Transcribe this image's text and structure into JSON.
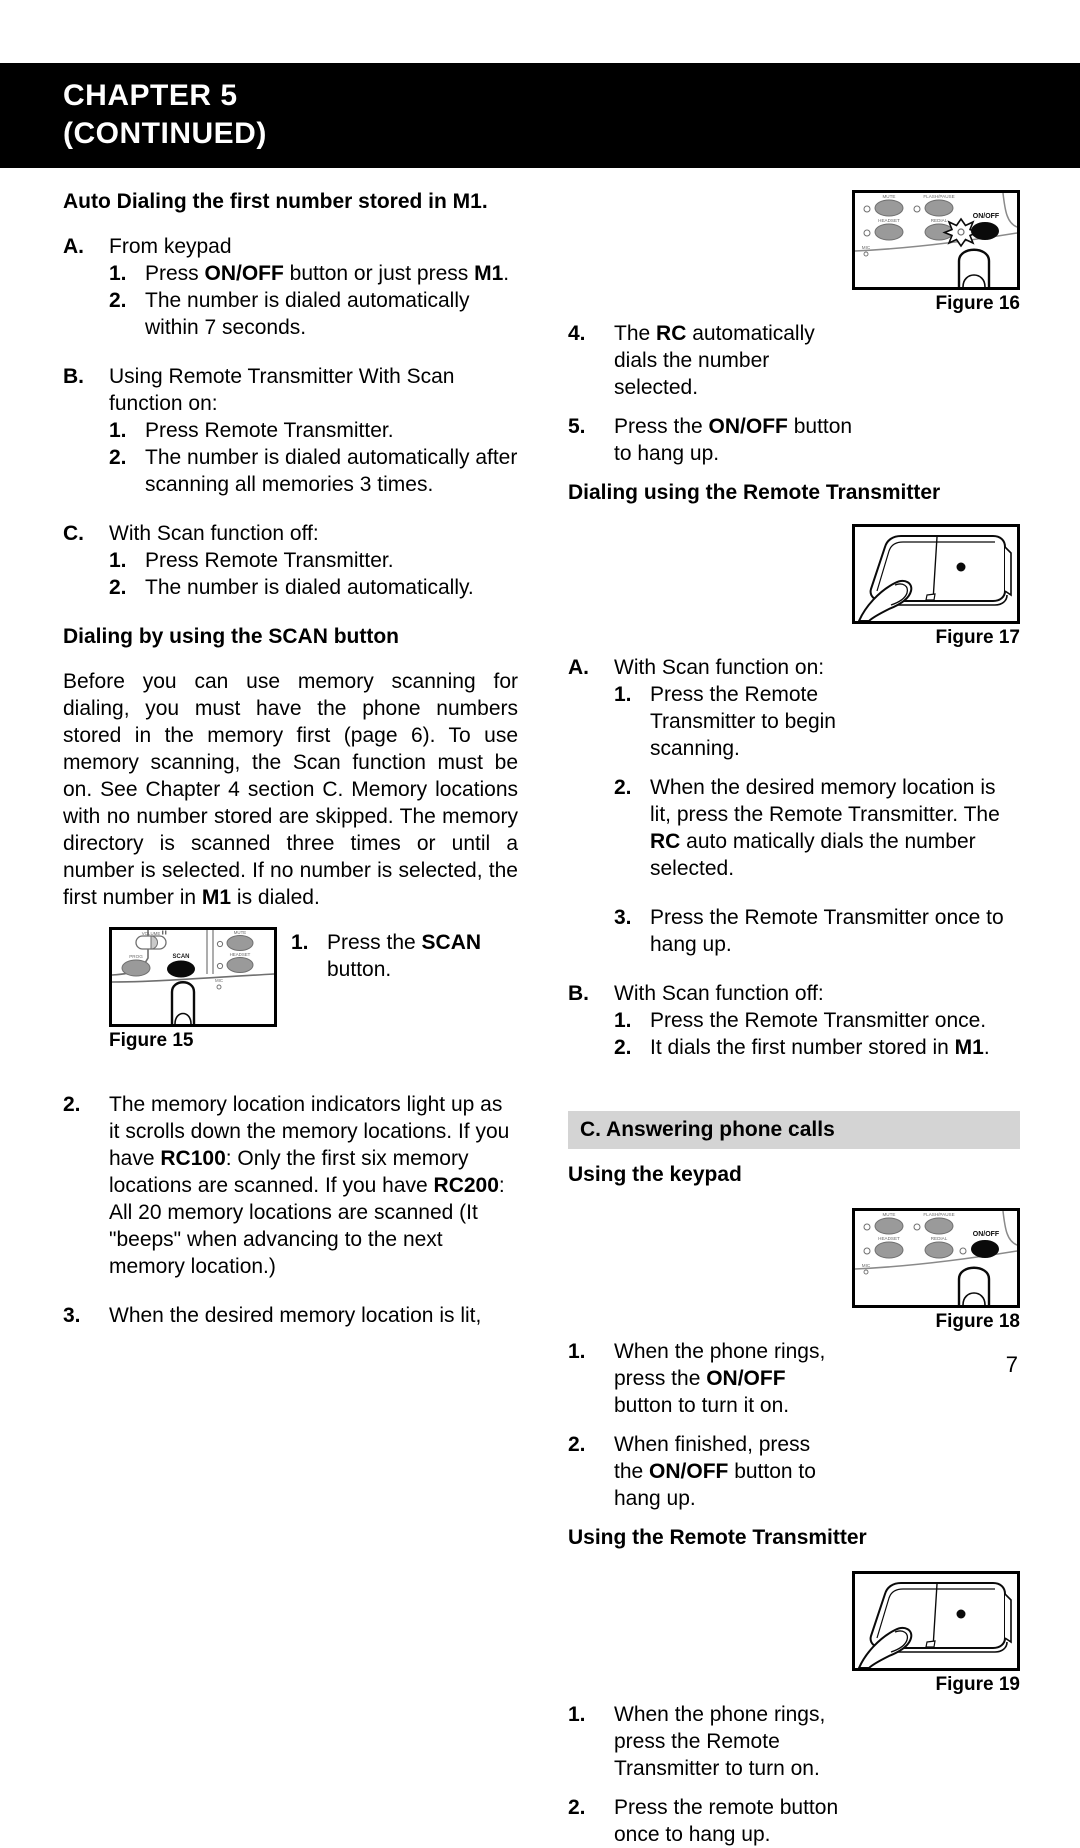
{
  "header": {
    "line1": "CHAPTER 5",
    "line2": "(CONTINUED)"
  },
  "page_number": "7",
  "colors": {
    "header_band": "#000000",
    "section_band": "#d4d4d4",
    "button_grey": "#9a9a9a",
    "text": "#000000"
  },
  "left_column": {
    "heading_auto_dial": "Auto Dialing the first number stored in M1.",
    "item_a": {
      "marker": "A.",
      "text": "From keypad"
    },
    "item_a1": {
      "marker": "1.",
      "pre": "Press ",
      "bold": "ON/OFF",
      "post": " button or just press ",
      "bold2": "M1",
      "tail": "."
    },
    "item_a2": {
      "marker": "2.",
      "text": "The number is dialed automatically within 7 seconds."
    },
    "item_b": {
      "marker": "B.",
      "text": "Using Remote Transmitter With Scan function on:"
    },
    "item_b1": {
      "marker": "1.",
      "text": "Press Remote Transmitter."
    },
    "item_b2": {
      "marker": "2.",
      "text": "The number is dialed automatically after scanning all memories 3 times."
    },
    "item_c": {
      "marker": "C.",
      "text": "With Scan function off:"
    },
    "item_c1": {
      "marker": "1.",
      "text": "Press Remote Transmitter."
    },
    "item_c2": {
      "marker": "2.",
      "text": "The number is dialed automatically."
    },
    "heading_scan": {
      "pre": "Dialing by using the ",
      "bold": "SCAN",
      "post": " button"
    },
    "paragraph_scan": "Before you can use memory scanning for dialing, you must have the phone numbers stored in the memory first (page 6). To use memory scanning, the Scan function must be on. See Chapter 4 section C.  Memory locations with no number stored are skipped. The memory directory is scanned three times or until a number is selected. If no number is selected, the first number in ",
    "paragraph_scan_bold": "M1",
    "paragraph_scan_tail": " is dialed.",
    "step_1": {
      "marker": "1.",
      "pre": "Press the ",
      "bold": "SCAN",
      "post": " button."
    },
    "step_2": {
      "marker": "2.",
      "text_a": "The memory location indicators light up as it scrolls down the memory locations. If you have ",
      "bold_a": "RC100",
      "text_b": ": Only the first six memory locations are scanned. If you have ",
      "bold_b": "RC200",
      "text_c": ": All 20 memory locations are scanned (It \"beeps\" when advancing to the next memory location.)"
    },
    "step_3": {
      "marker": "3.",
      "text": "When the desired memory location is lit,"
    }
  },
  "right_column": {
    "item_4": {
      "marker": "4.",
      "pre": "The ",
      "bold": "RC",
      "post": " automatically dials the number selected."
    },
    "item_5": {
      "marker": "5.",
      "pre": "Press the ",
      "bold": "ON/OFF",
      "post": " button to hang up."
    },
    "heading_dialing_remote": "Dialing using the Remote Transmitter",
    "item_a": {
      "marker": "A.",
      "text": "With Scan function on:"
    },
    "item_a1": {
      "marker": "1.",
      "text": "Press the Remote Transmitter to begin scanning."
    },
    "item_a2": {
      "marker": "2.",
      "pre": "When the desired memory location is lit, press the Remote Transmitter. The ",
      "bold": "RC",
      "post": " auto matically dials the number selected."
    },
    "item_a3": {
      "marker": "3.",
      "text": "Press the Remote Transmitter once to hang up."
    },
    "item_b": {
      "marker": "B.",
      "text": "With Scan function off:"
    },
    "item_b1": {
      "marker": "1.",
      "text": "Press the Remote Transmitter once."
    },
    "item_b2": {
      "marker": "2.",
      "pre": "It dials the first number stored in ",
      "bold": "M1",
      "post": "."
    },
    "section_c": "C. Answering phone calls",
    "heading_keypad": "Using the keypad",
    "keypad_1": {
      "marker": "1.",
      "pre": "When the phone rings, press the ",
      "bold": "ON/OFF",
      "post": " button to turn it on."
    },
    "keypad_2": {
      "marker": "2.",
      "pre": "When finished, press the ",
      "bold": "ON/OFF",
      "post": " button to hang up."
    },
    "heading_remote": "Using the Remote Transmitter",
    "remote_1": {
      "marker": "1.",
      "text": "When the phone rings, press the Remote Transmitter to turn on."
    },
    "remote_2": {
      "marker": "2.",
      "text": "Press the remote button once to hang up."
    }
  },
  "figures": {
    "fig15": {
      "caption": "Figure 15",
      "labels": {
        "volume": "VOLUME",
        "prog": "PROG",
        "scan": "SCAN",
        "mute": "MUTE",
        "headset": "HEADSET",
        "mic": "MIC"
      }
    },
    "fig16": {
      "caption": "Figure 16",
      "labels": {
        "mute": "MUTE",
        "flash": "FLASH/PAUSE",
        "headset": "HEADSET",
        "redial": "REDIAL",
        "mic": "MIC",
        "onoff": "ON/OFF"
      }
    },
    "fig17": {
      "caption": "Figure 17"
    },
    "fig18": {
      "caption": "Figure 18",
      "labels": {
        "mute": "MUTE",
        "flash": "FLASH/PAUSE",
        "headset": "HEADSET",
        "redial": "REDIAL",
        "mic": "MIC",
        "onoff": "ON/OFF"
      }
    },
    "fig19": {
      "caption": "Figure 19"
    }
  }
}
